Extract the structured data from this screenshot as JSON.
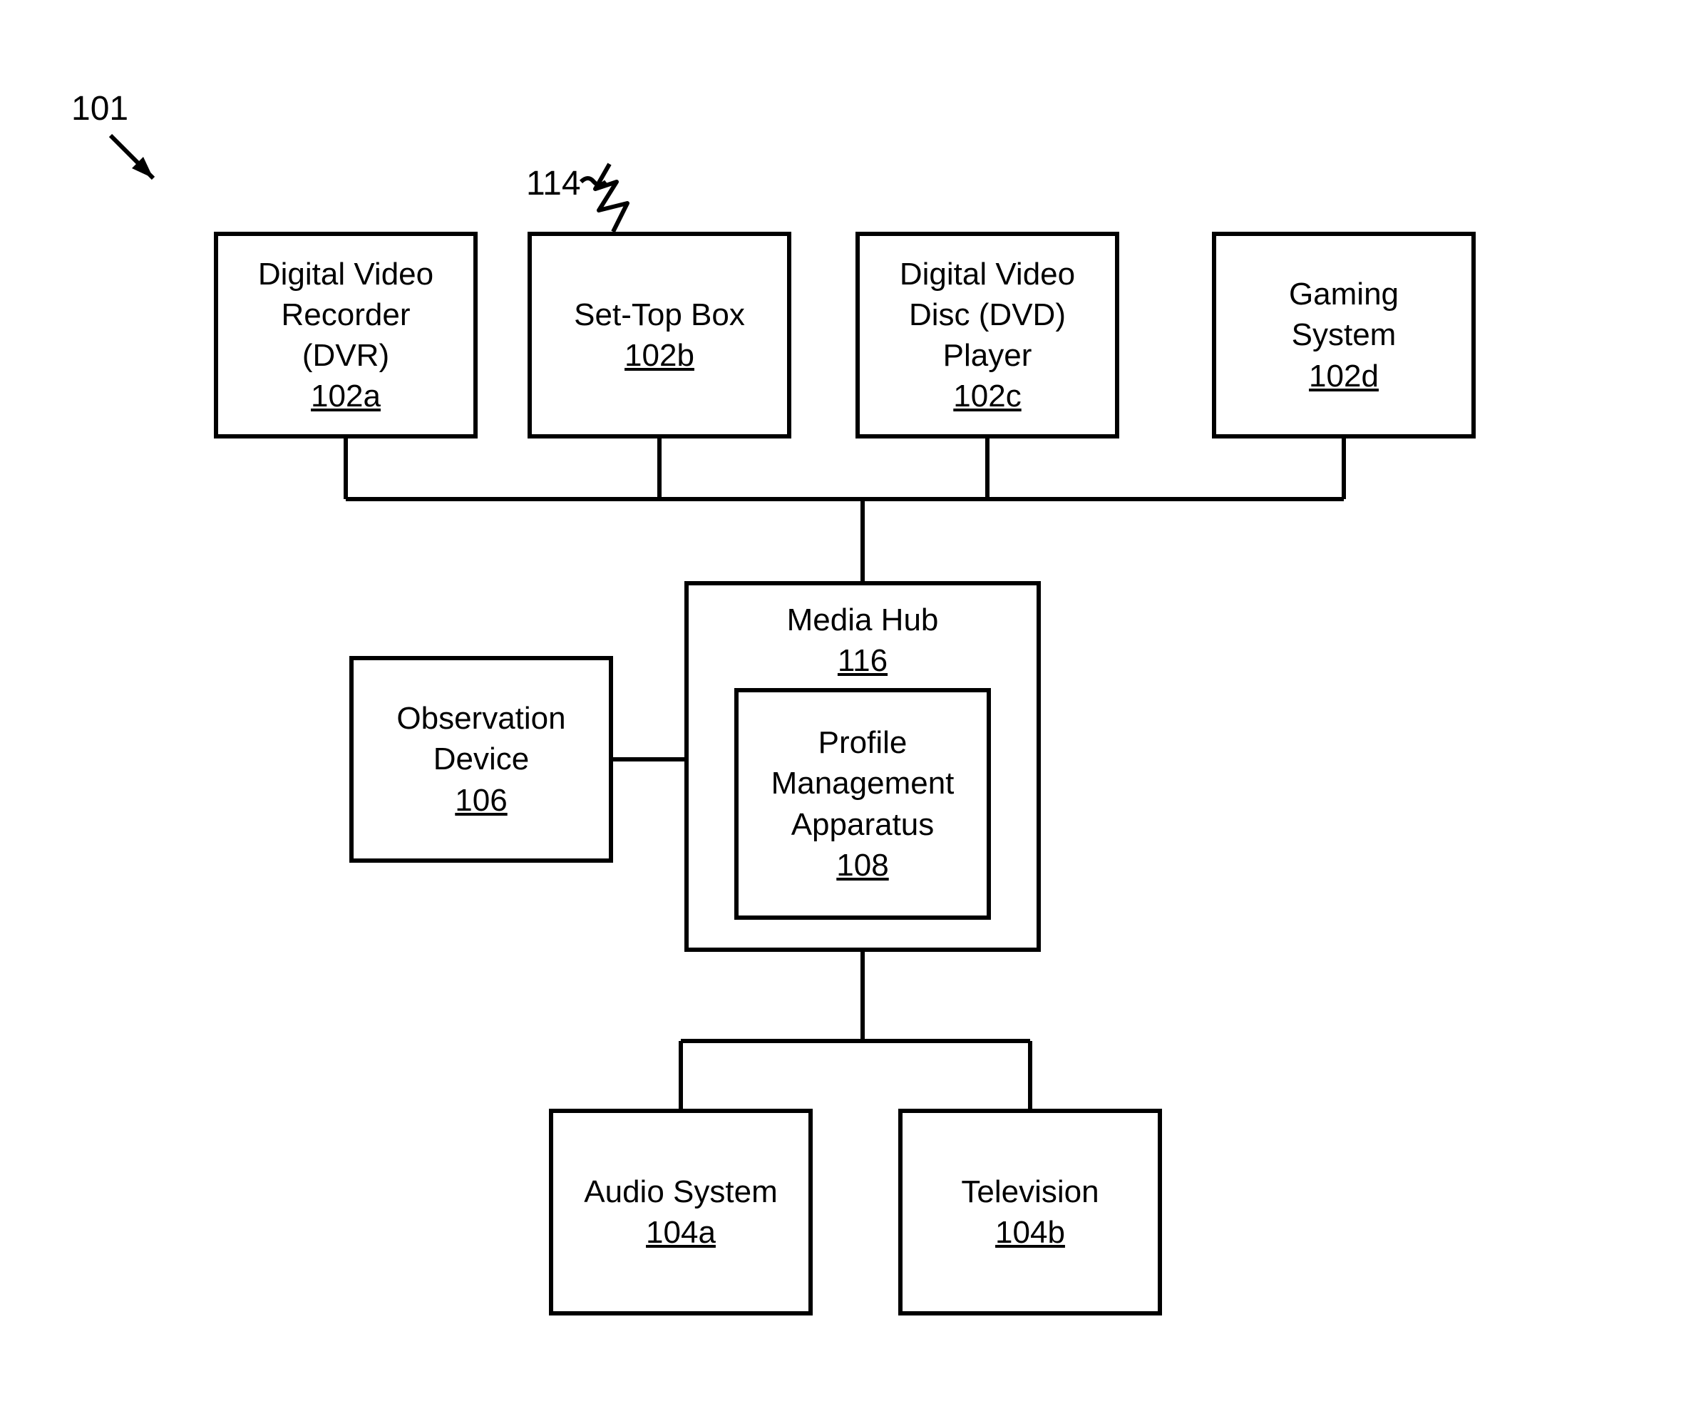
{
  "figure_ref": "101",
  "antenna_ref": "114",
  "blocks": {
    "dvr": {
      "line1": "Digital Video",
      "line2": "Recorder",
      "line3": "(DVR)",
      "ref": "102a"
    },
    "stb": {
      "line1": "Set-Top Box",
      "ref": "102b"
    },
    "dvd": {
      "line1": "Digital Video",
      "line2": "Disc (DVD)",
      "line3": "Player",
      "ref": "102c"
    },
    "game": {
      "line1": "Gaming",
      "line2": "System",
      "ref": "102d"
    },
    "obs": {
      "line1": "Observation",
      "line2": "Device",
      "ref": "106"
    },
    "hub": {
      "line1": "Media Hub",
      "ref": "116"
    },
    "pma": {
      "line1": "Profile",
      "line2": "Management",
      "line3": "Apparatus",
      "ref": "108"
    },
    "audio": {
      "line1": "Audio System",
      "ref": "104a"
    },
    "tv": {
      "line1": "Television",
      "ref": "104b"
    }
  },
  "chart_data": {
    "type": "diagram",
    "title": "",
    "nodes": [
      {
        "id": "102a",
        "label": "Digital Video Recorder (DVR)"
      },
      {
        "id": "102b",
        "label": "Set-Top Box"
      },
      {
        "id": "102c",
        "label": "Digital Video Disc (DVD) Player"
      },
      {
        "id": "102d",
        "label": "Gaming System"
      },
      {
        "id": "106",
        "label": "Observation Device"
      },
      {
        "id": "116",
        "label": "Media Hub"
      },
      {
        "id": "108",
        "label": "Profile Management Apparatus",
        "parent": "116"
      },
      {
        "id": "104a",
        "label": "Audio System"
      },
      {
        "id": "104b",
        "label": "Television"
      },
      {
        "id": "114",
        "label": "Antenna (wireless)",
        "attached_to": "102b"
      }
    ],
    "edges": [
      {
        "from": "102a",
        "to": "116"
      },
      {
        "from": "102b",
        "to": "116"
      },
      {
        "from": "102c",
        "to": "116"
      },
      {
        "from": "102d",
        "to": "116"
      },
      {
        "from": "106",
        "to": "116"
      },
      {
        "from": "116",
        "to": "104a"
      },
      {
        "from": "116",
        "to": "104b"
      }
    ],
    "figure_pointer": {
      "label": "101",
      "points_to": "figure"
    }
  }
}
